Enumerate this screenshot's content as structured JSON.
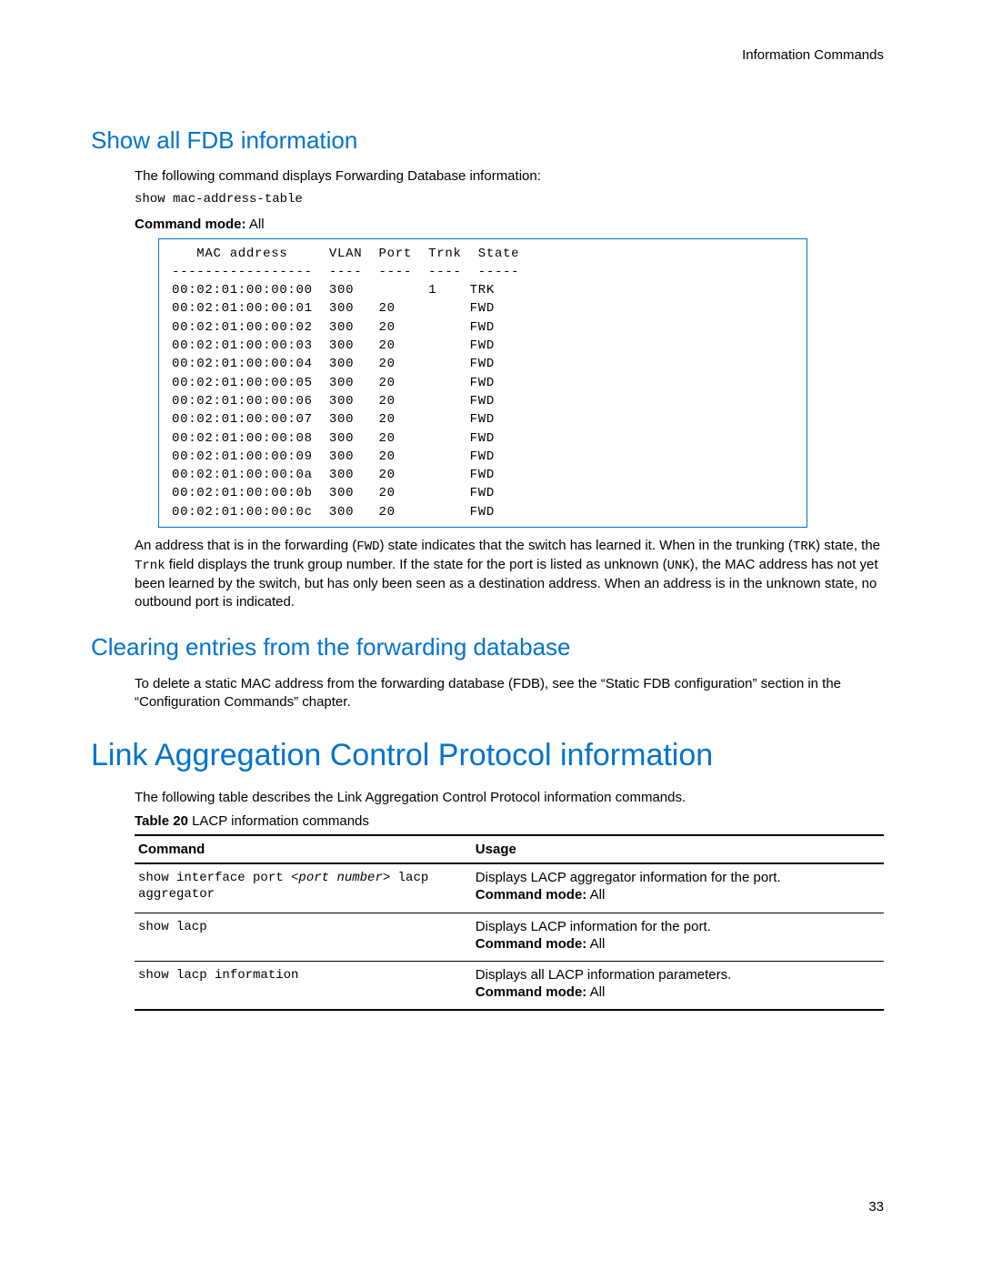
{
  "running_head": "Information Commands",
  "page_number": "33",
  "sec1": {
    "title": "Show all FDB information",
    "intro": "The following command displays Forwarding Database information:",
    "command": "show mac-address-table",
    "mode_label": "Command mode:",
    "mode_value": " All",
    "output_header": "   MAC address     VLAN  Port  Trnk  State",
    "output_sep": "-----------------  ----  ----  ----  -----",
    "output_rows": [
      "00:02:01:00:00:00  300         1    TRK",
      "00:02:01:00:00:01  300   20         FWD",
      "00:02:01:00:00:02  300   20         FWD",
      "00:02:01:00:00:03  300   20         FWD",
      "00:02:01:00:00:04  300   20         FWD",
      "00:02:01:00:00:05  300   20         FWD",
      "00:02:01:00:00:06  300   20         FWD",
      "00:02:01:00:00:07  300   20         FWD",
      "00:02:01:00:00:08  300   20         FWD",
      "00:02:01:00:00:09  300   20         FWD",
      "00:02:01:00:00:0a  300   20         FWD",
      "00:02:01:00:00:0b  300   20         FWD",
      "00:02:01:00:00:0c  300   20         FWD"
    ],
    "after1a": "An address that is in the forwarding (",
    "after1b": "FWD",
    "after1c": ") state indicates that the switch has learned it. When in the trunking (",
    "after1d": "TRK",
    "after1e": ") state, the ",
    "after1f": "Trnk",
    "after1g": " field displays the trunk group number. If the state for the port is listed as unknown (",
    "after1h": "UNK",
    "after1i": "), the MAC address has not yet been learned by the switch, but has only been seen as a destination address. When an address is in the unknown state, no outbound port is indicated."
  },
  "sec2": {
    "title": "Clearing entries from the forwarding database",
    "para": "To delete a static MAC address from the forwarding database (FDB), see the “Static FDB configuration” section in the “Configuration Commands” chapter."
  },
  "sec3": {
    "title": "Link Aggregation Control Protocol information",
    "intro": "The following table describes the Link Aggregation Control Protocol information commands.",
    "caption_label": "Table 20",
    "caption_text": "  LACP information commands",
    "th_cmd": "Command",
    "th_usage": "Usage",
    "rows": [
      {
        "cmd_pre": "show interface port ",
        "cmd_arg": "<port number>",
        "cmd_post": " lacp aggregator",
        "usage": "Displays LACP aggregator information for the port.",
        "mode_label": "Command mode:",
        "mode_value": " All"
      },
      {
        "cmd_pre": "show lacp",
        "cmd_arg": "",
        "cmd_post": "",
        "usage": "Displays LACP information for the port.",
        "mode_label": "Command mode:",
        "mode_value": " All"
      },
      {
        "cmd_pre": "show lacp information",
        "cmd_arg": "",
        "cmd_post": "",
        "usage": "Displays all LACP information parameters.",
        "mode_label": "Command mode:",
        "mode_value": " All"
      }
    ]
  }
}
